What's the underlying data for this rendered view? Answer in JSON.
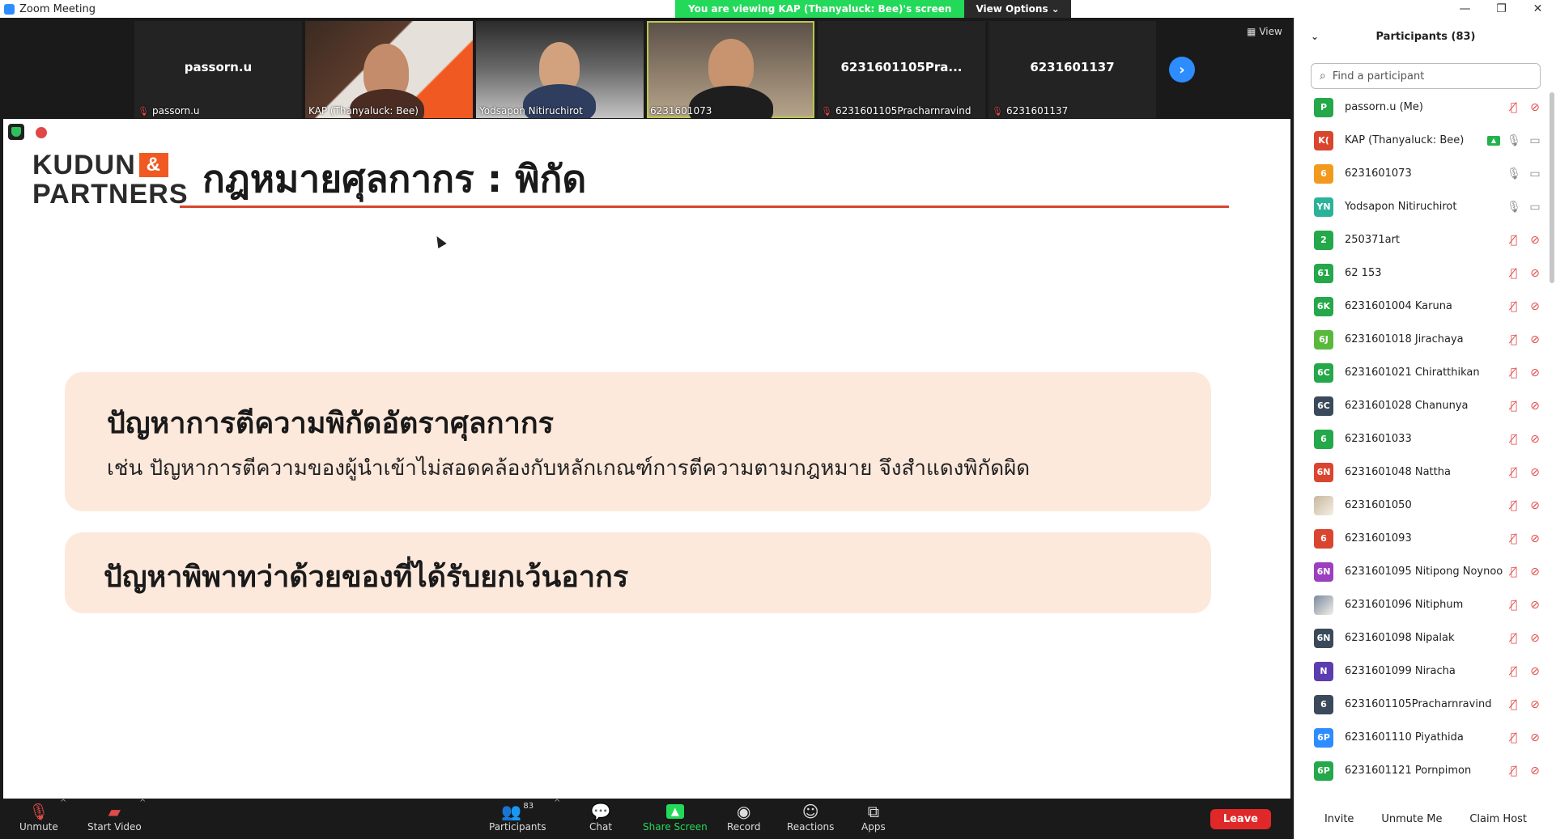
{
  "window": {
    "title": "Zoom Meeting",
    "controls": [
      "—",
      "❐",
      "✕"
    ]
  },
  "banner": {
    "message": "You are viewing KAP (Thanyaluck: Bee)'s screen",
    "options": "View Options",
    "options_caret": "⌄"
  },
  "video_strip": {
    "tiles": [
      {
        "label": "passorn.u",
        "center_name": "passorn.u",
        "muted": true
      },
      {
        "label": "KAP (Thanyaluck: Bee)",
        "center_name": "",
        "muted": false
      },
      {
        "label": "Yodsapon Nitiruchirot",
        "center_name": "",
        "muted": false
      },
      {
        "label": "6231601073",
        "center_name": "",
        "muted": false
      },
      {
        "label": "6231601105Pracharnravind",
        "center_name": "6231601105Pra...",
        "muted": true
      },
      {
        "label": "6231601137",
        "center_name": "6231601137",
        "muted": true
      }
    ],
    "view_label": "View"
  },
  "slide": {
    "logo_line1": "KUDUN",
    "logo_amp": "&",
    "logo_line2": "PARTNERS",
    "title": "กฎหมายศุลกากร : พิกัด",
    "card1_heading": "ปัญหาการตีความพิกัดอัตราศุลกากร",
    "card1_text": "เช่น ปัญหาการตีความของผู้นำเข้าไม่สอดคล้องกับหลักเกณฑ์การตีความตามกฎหมาย จึงสำแดงพิกัดผิด",
    "card2_heading": "ปัญหาพิพาทว่าด้วยของที่ได้รับยกเว้นอากร"
  },
  "toolbar": {
    "unmute": "Unmute",
    "start_video": "Start Video",
    "participants": "Participants",
    "participants_count": "83",
    "chat": "Chat",
    "share_screen": "Share Screen",
    "record": "Record",
    "reactions": "Reactions",
    "apps": "Apps",
    "leave": "Leave"
  },
  "panel": {
    "title": "Participants (83)",
    "search_placeholder": "Find a participant",
    "participants": [
      {
        "initials": "P",
        "color": "#24a84a",
        "name": "passorn.u (Me)",
        "mic": "muted",
        "video": "off"
      },
      {
        "initials": "K(",
        "color": "#d9452e",
        "name": "KAP (Thanyaluck: Bee)",
        "mic": "on",
        "video": "on",
        "sharing": true
      },
      {
        "initials": "6",
        "color": "#f39a1e",
        "name": "6231601073",
        "mic": "on",
        "video": "on"
      },
      {
        "initials": "YN",
        "color": "#2bb39a",
        "name": "Yodsapon Nitiruchirot",
        "mic": "on",
        "video": "on"
      },
      {
        "initials": "2",
        "color": "#24a84a",
        "name": "250371art",
        "mic": "muted",
        "video": "off"
      },
      {
        "initials": "61",
        "color": "#24a84a",
        "name": "62 153",
        "mic": "muted",
        "video": "off"
      },
      {
        "initials": "6K",
        "color": "#24a84a",
        "name": "6231601004 Karuna",
        "mic": "muted",
        "video": "off"
      },
      {
        "initials": "6J",
        "color": "#5ab83c",
        "name": "6231601018 Jirachaya",
        "mic": "muted",
        "video": "off"
      },
      {
        "initials": "6C",
        "color": "#24a84a",
        "name": "6231601021 Chiratthikan",
        "mic": "muted",
        "video": "off"
      },
      {
        "initials": "6C",
        "color": "#3b4a5a",
        "name": "6231601028 Chanunya",
        "mic": "muted",
        "video": "off"
      },
      {
        "initials": "6",
        "color": "#24a84a",
        "name": "6231601033",
        "mic": "muted",
        "video": "off"
      },
      {
        "initials": "6N",
        "color": "#d9452e",
        "name": "6231601048 Nattha",
        "mic": "muted",
        "video": "off"
      },
      {
        "initials": "",
        "color": "#c9b79c",
        "name": "6231601050",
        "mic": "muted",
        "video": "off",
        "photo": true
      },
      {
        "initials": "6",
        "color": "#d9452e",
        "name": "6231601093",
        "mic": "muted",
        "video": "off"
      },
      {
        "initials": "6N",
        "color": "#9b3fbf",
        "name": "6231601095 Nitipong Noynoo",
        "mic": "muted",
        "video": "off"
      },
      {
        "initials": "",
        "color": "#7a8aa0",
        "name": "6231601096 Nitiphum",
        "mic": "muted",
        "video": "off",
        "photo": true
      },
      {
        "initials": "6N",
        "color": "#3b4a5a",
        "name": "6231601098 Nipalak",
        "mic": "muted",
        "video": "off"
      },
      {
        "initials": "N",
        "color": "#5b3db0",
        "name": "6231601099 Niracha",
        "mic": "muted",
        "video": "off"
      },
      {
        "initials": "6",
        "color": "#3b4a5a",
        "name": "6231601105Pracharnravind",
        "mic": "muted",
        "video": "off"
      },
      {
        "initials": "6P",
        "color": "#2d8cff",
        "name": "6231601110 Piyathida",
        "mic": "muted",
        "video": "off"
      },
      {
        "initials": "6P",
        "color": "#24a84a",
        "name": "6231601121 Pornpimon",
        "mic": "muted",
        "video": "off"
      }
    ],
    "footer": {
      "invite": "Invite",
      "unmute_me": "Unmute Me",
      "claim_host": "Claim Host"
    }
  },
  "colors": {
    "accent": "#2d8cff",
    "share_green": "#23d959",
    "leave_red": "#e02828",
    "card_bg": "#fde9dc",
    "brand_orange": "#f05a22"
  }
}
